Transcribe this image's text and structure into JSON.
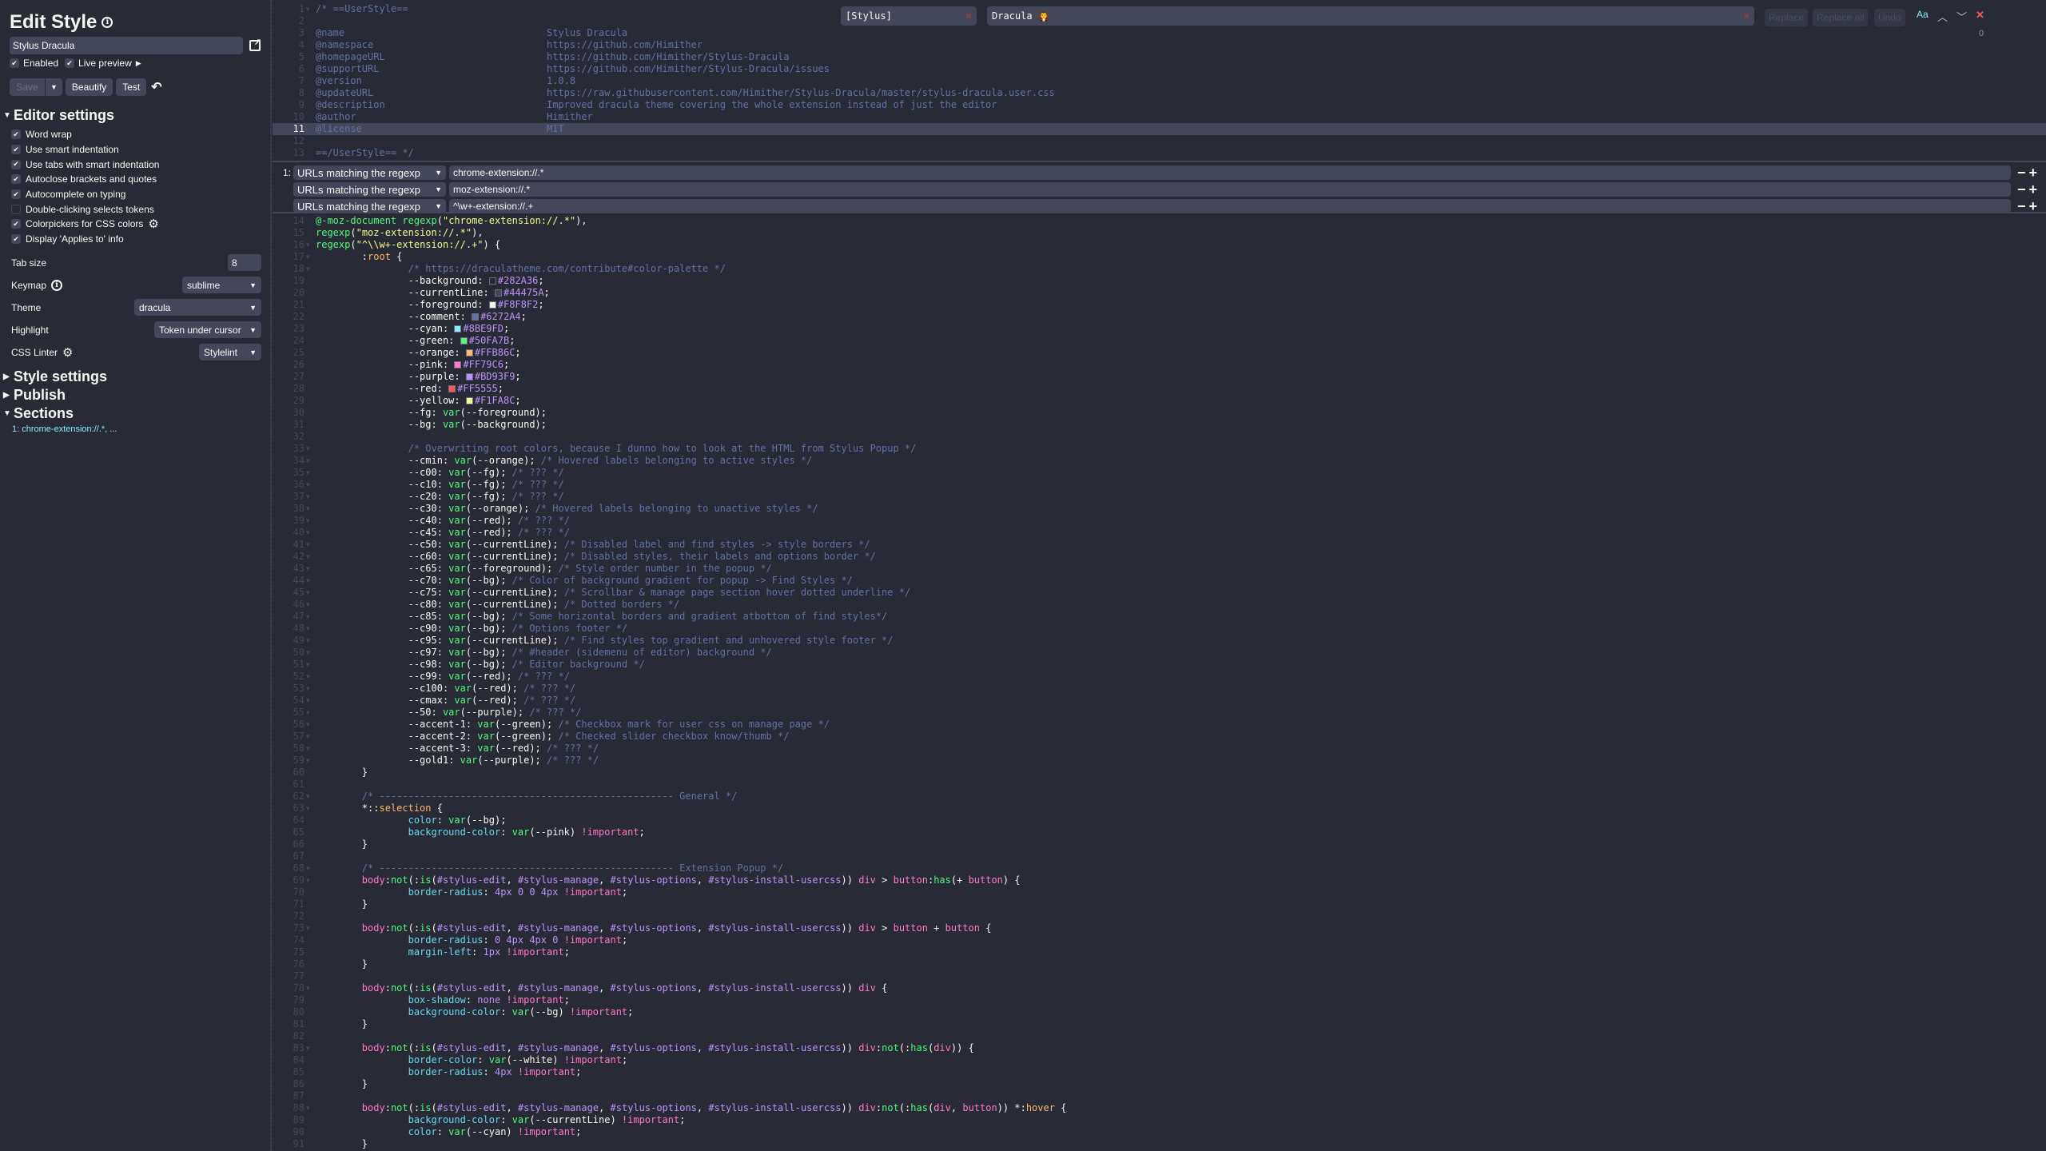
{
  "sidebar": {
    "title": "Edit Style",
    "style_name": "Stylus Dracula",
    "enabled_label": "Enabled",
    "enabled": true,
    "live_preview_label": "Live preview",
    "live_preview": true,
    "save_label": "Save",
    "beautify_label": "Beautify",
    "test_label": "Test",
    "editor_settings_heading": "Editor settings",
    "options": [
      {
        "label": "Word wrap",
        "checked": true
      },
      {
        "label": "Use smart indentation",
        "checked": true
      },
      {
        "label": "Use tabs with smart indentation",
        "checked": true
      },
      {
        "label": "Autoclose brackets and quotes",
        "checked": true
      },
      {
        "label": "Autocomplete on typing",
        "checked": true
      },
      {
        "label": "Double-clicking selects tokens",
        "checked": false
      },
      {
        "label": "Colorpickers for CSS colors",
        "checked": true
      },
      {
        "label": "Display 'Applies to' info",
        "checked": true
      }
    ],
    "tab_size_label": "Tab size",
    "tab_size": "8",
    "keymap_label": "Keymap",
    "keymap": "sublime",
    "theme_label": "Theme",
    "theme": "dracula",
    "highlight_label": "Highlight",
    "highlight": "Token under cursor",
    "linter_label": "CSS Linter",
    "linter": "Stylelint",
    "style_settings_heading": "Style settings",
    "publish_heading": "Publish",
    "sections_heading": "Sections",
    "sections_item": "1: chrome-extension://.*, ..."
  },
  "search": {
    "find_value": "[Stylus]",
    "replace_value": "Dracula 🧛",
    "replace_label": "Replace",
    "replace_all_label": "Replace all",
    "undo_label": "Undo",
    "case_label": "Aa",
    "count": "0"
  },
  "applies": {
    "rows": [
      {
        "num": "1:",
        "type": "URLs matching the regexp",
        "value": "chrome-extension://.*"
      },
      {
        "num": "",
        "type": "URLs matching the regexp",
        "value": "moz-extension://.*"
      },
      {
        "num": "",
        "type": "URLs matching the regexp",
        "value": "^\\w+-extension://.+"
      }
    ]
  },
  "header_code": {
    "active_line": 11,
    "lines": [
      {
        "n": "1",
        "fold": true,
        "html": "<span class='cm'>/* ==UserStyle==</span>"
      },
      {
        "n": "2",
        "html": ""
      },
      {
        "n": "3",
        "html": "<span class='cm'>@name                                   Stylus Dracula</span>"
      },
      {
        "n": "4",
        "html": "<span class='cm'>@namespace                              https://github.com/Himither</span>"
      },
      {
        "n": "5",
        "html": "<span class='cm'>@homepageURL                            https://github.com/Himither/Stylus-Dracula</span>"
      },
      {
        "n": "6",
        "html": "<span class='cm'>@supportURL                             https://github.com/Himither/Stylus-Dracula/issues</span>"
      },
      {
        "n": "7",
        "html": "<span class='cm'>@version                                1.0.8</span>"
      },
      {
        "n": "8",
        "html": "<span class='cm'>@updateURL                              https://raw.githubusercontent.com/Himither/Stylus-Dracula/master/stylus-dracula.user.css</span>"
      },
      {
        "n": "9",
        "html": "<span class='cm'>@description                            Improved dracula theme covering the whole extension instead of just the editor</span>"
      },
      {
        "n": "10",
        "html": "<span class='cm'>@author                                 Himither</span>"
      },
      {
        "n": "11",
        "html": "<span class='cm'>@license                                </span><span class='sel-txt'>MIT</span>"
      },
      {
        "n": "12",
        "html": ""
      },
      {
        "n": "13",
        "html": "<span class='cm'>==/UserStyle== */</span>"
      }
    ]
  },
  "body_code": {
    "lines": [
      {
        "n": "14",
        "html": "<span class='fn'>@-moz-document</span> <span class='fn'>regexp</span>(<span class='st'>\"chrome-extension://.*\"</span>),"
      },
      {
        "n": "15",
        "html": "<span class='fn'>regexp</span>(<span class='st'>\"moz-extension://.*\"</span>),"
      },
      {
        "n": "16",
        "fold": true,
        "html": "<span class='fn'>regexp</span>(<span class='st'>\"^\\\\w+-extension://.+\"</span>) {"
      },
      {
        "n": "17",
        "fold": true,
        "html": "\t:<span class='at'>root</span> {"
      },
      {
        "n": "18",
        "fold": true,
        "html": "\t\t<span class='cm'>/* https://draculatheme.com/contribute#color-palette */</span>"
      },
      {
        "n": "19",
        "html": "\t\t--background: <span class='sw' style='background:#282A36'></span><span class='nm'>#282A36</span>;"
      },
      {
        "n": "20",
        "html": "\t\t--currentLine: <span class='sw' style='background:#44475A'></span><span class='nm'>#44475A</span>;"
      },
      {
        "n": "21",
        "html": "\t\t--foreground: <span class='sw' style='background:#F8F8F2'></span><span class='nm'>#F8F8F2</span>;"
      },
      {
        "n": "22",
        "html": "\t\t--comment: <span class='sw' style='background:#6272A4'></span><span class='nm'>#6272A4</span>;"
      },
      {
        "n": "23",
        "html": "\t\t--cyan: <span class='sw' style='background:#8BE9FD'></span><span class='nm'>#8BE9FD</span>;"
      },
      {
        "n": "24",
        "html": "\t\t--green: <span class='sw' style='background:#50FA7B'></span><span class='nm'>#50FA7B</span>;"
      },
      {
        "n": "25",
        "html": "\t\t--orange: <span class='sw' style='background:#FFB86C'></span><span class='nm'>#FFB86C</span>;"
      },
      {
        "n": "26",
        "html": "\t\t--pink: <span class='sw' style='background:#FF79C6'></span><span class='nm'>#FF79C6</span>;"
      },
      {
        "n": "27",
        "html": "\t\t--purple: <span class='sw' style='background:#BD93F9'></span><span class='nm'>#BD93F9</span>;"
      },
      {
        "n": "28",
        "html": "\t\t--red: <span class='sw' style='background:#FF5555'></span><span class='nm'>#FF5555</span>;"
      },
      {
        "n": "29",
        "html": "\t\t--yellow: <span class='sw' style='background:#F1FA8C'></span><span class='nm'>#F1FA8C</span>;"
      },
      {
        "n": "30",
        "html": "\t\t--fg: <span class='fn'>var</span>(--foreground);"
      },
      {
        "n": "31",
        "html": "\t\t--bg: <span class='fn'>var</span>(--background);"
      },
      {
        "n": "32",
        "html": ""
      },
      {
        "n": "33",
        "fold": true,
        "html": "\t\t<span class='cm'>/* Overwriting root colors, because I dunno how to look at the HTML from Stylus Popup */</span>"
      },
      {
        "n": "34",
        "fold": true,
        "html": "\t\t--cmin: <span class='fn'>var</span>(--orange); <span class='cm'>/* Hovered labels belonging to active styles */</span>"
      },
      {
        "n": "35",
        "fold": true,
        "html": "\t\t--c00: <span class='fn'>var</span>(--fg); <span class='cm'>/* ??? */</span>"
      },
      {
        "n": "36",
        "fold": true,
        "html": "\t\t--c10: <span class='fn'>var</span>(--fg); <span class='cm'>/* ??? */</span>"
      },
      {
        "n": "37",
        "fold": true,
        "html": "\t\t--c20: <span class='fn'>var</span>(--fg); <span class='cm'>/* ??? */</span>"
      },
      {
        "n": "38",
        "fold": true,
        "html": "\t\t--c30: <span class='fn'>var</span>(--orange); <span class='cm'>/* Hovered labels belonging to unactive styles */</span>"
      },
      {
        "n": "39",
        "fold": true,
        "html": "\t\t--c40: <span class='fn'>var</span>(--red); <span class='cm'>/* ??? */</span>"
      },
      {
        "n": "40",
        "fold": true,
        "html": "\t\t--c45: <span class='fn'>var</span>(--red); <span class='cm'>/* ??? */</span>"
      },
      {
        "n": "41",
        "fold": true,
        "html": "\t\t--c50: <span class='fn'>var</span>(--currentLine); <span class='cm'>/* Disabled label and find styles -> style borders */</span>"
      },
      {
        "n": "42",
        "fold": true,
        "html": "\t\t--c60: <span class='fn'>var</span>(--currentLine); <span class='cm'>/* Disabled styles, their labels and options border */</span>"
      },
      {
        "n": "43",
        "fold": true,
        "html": "\t\t--c65: <span class='fn'>var</span>(--foreground); <span class='cm'>/* Style order number in the popup */</span>"
      },
      {
        "n": "44",
        "fold": true,
        "html": "\t\t--c70: <span class='fn'>var</span>(--bg); <span class='cm'>/* Color of background gradient for popup -> Find Styles */</span>"
      },
      {
        "n": "45",
        "fold": true,
        "html": "\t\t--c75: <span class='fn'>var</span>(--currentLine); <span class='cm'>/* Scrollbar &amp; manage page section hover dotted underline */</span>"
      },
      {
        "n": "46",
        "fold": true,
        "html": "\t\t--c80: <span class='fn'>var</span>(--currentLine); <span class='cm'>/* Dotted borders */</span>"
      },
      {
        "n": "47",
        "fold": true,
        "html": "\t\t--c85: <span class='fn'>var</span>(--bg); <span class='cm'>/* Some horizontal borders and gradient atbottom of find styles*/</span>"
      },
      {
        "n": "48",
        "fold": true,
        "html": "\t\t--c90: <span class='fn'>var</span>(--bg); <span class='cm'>/* Options footer */</span>"
      },
      {
        "n": "49",
        "fold": true,
        "html": "\t\t--c95: <span class='fn'>var</span>(--currentLine); <span class='cm'>/* Find styles top gradient and unhovered style footer */</span>"
      },
      {
        "n": "50",
        "fold": true,
        "html": "\t\t--c97: <span class='fn'>var</span>(--bg); <span class='cm'>/* #header (sidemenu of editor) background */</span>"
      },
      {
        "n": "51",
        "fold": true,
        "html": "\t\t--c98: <span class='fn'>var</span>(--bg); <span class='cm'>/* Editor background */</span>"
      },
      {
        "n": "52",
        "fold": true,
        "html": "\t\t--c99: <span class='fn'>var</span>(--red); <span class='cm'>/* ??? */</span>"
      },
      {
        "n": "53",
        "fold": true,
        "html": "\t\t--c100: <span class='fn'>var</span>(--red); <span class='cm'>/* ??? */</span>"
      },
      {
        "n": "54",
        "fold": true,
        "html": "\t\t--cmax: <span class='fn'>var</span>(--red); <span class='cm'>/* ??? */</span>"
      },
      {
        "n": "55",
        "fold": true,
        "html": "\t\t--50: <span class='fn'>var</span>(--purple); <span class='cm'>/* ??? */</span>"
      },
      {
        "n": "56",
        "fold": true,
        "html": "\t\t--accent-1: <span class='fn'>var</span>(--green); <span class='cm'>/* Checkbox mark for user css on manage page */</span>"
      },
      {
        "n": "57",
        "fold": true,
        "html": "\t\t--accent-2: <span class='fn'>var</span>(--green); <span class='cm'>/* Checked slider checkbox know/thumb */</span>"
      },
      {
        "n": "58",
        "fold": true,
        "html": "\t\t--accent-3: <span class='fn'>var</span>(--red); <span class='cm'>/* ??? */</span>"
      },
      {
        "n": "59",
        "fold": true,
        "html": "\t\t--gold1: <span class='fn'>var</span>(--purple); <span class='cm'>/* ??? */</span>"
      },
      {
        "n": "60",
        "html": "\t}"
      },
      {
        "n": "61",
        "html": ""
      },
      {
        "n": "62",
        "fold": true,
        "html": "\t<span class='cm'>/* --------------------------------------------------- General */</span>"
      },
      {
        "n": "63",
        "fold": true,
        "html": "\t*::<span class='at'>selection</span> {"
      },
      {
        "n": "64",
        "html": "\t\t<span class='pr'>color</span>: <span class='fn'>var</span>(--bg);"
      },
      {
        "n": "65",
        "html": "\t\t<span class='pr'>background-color</span>: <span class='fn'>var</span>(--pink) <span class='kw'>!important</span>;"
      },
      {
        "n": "66",
        "html": "\t}"
      },
      {
        "n": "67",
        "html": ""
      },
      {
        "n": "68",
        "fold": true,
        "html": "\t<span class='cm'>/* --------------------------------------------------- Extension Popup */</span>"
      },
      {
        "n": "69",
        "fold": true,
        "html": "\t<span class='kw'>body</span>:<span class='fn'>not</span>(:<span class='fn'>is</span>(<span class='nm'>#stylus-edit</span>, <span class='nm'>#stylus-manage</span>, <span class='nm'>#stylus-options</span>, <span class='nm'>#stylus-install-usercss</span>)) <span class='kw'>div</span> &gt; <span class='kw'>button</span>:<span class='fn'>has</span>(+ <span class='kw'>button</span>) {"
      },
      {
        "n": "70",
        "html": "\t\t<span class='pr'>border-radius</span>: <span class='nm'>4px 0 0 4px</span> <span class='kw'>!important</span>;"
      },
      {
        "n": "71",
        "html": "\t}"
      },
      {
        "n": "72",
        "html": ""
      },
      {
        "n": "73",
        "fold": true,
        "html": "\t<span class='kw'>body</span>:<span class='fn'>not</span>(:<span class='fn'>is</span>(<span class='nm'>#stylus-edit</span>, <span class='nm'>#stylus-manage</span>, <span class='nm'>#stylus-options</span>, <span class='nm'>#stylus-install-usercss</span>)) <span class='kw'>div</span> &gt; <span class='kw'>button</span> + <span class='kw'>button</span> {"
      },
      {
        "n": "74",
        "html": "\t\t<span class='pr'>border-radius</span>: <span class='nm'>0 4px 4px 0</span> <span class='kw'>!important</span>;"
      },
      {
        "n": "75",
        "html": "\t\t<span class='pr'>margin-left</span>: <span class='nm'>1px</span> <span class='kw'>!important</span>;"
      },
      {
        "n": "76",
        "html": "\t}"
      },
      {
        "n": "77",
        "html": ""
      },
      {
        "n": "78",
        "fold": true,
        "html": "\t<span class='kw'>body</span>:<span class='fn'>not</span>(:<span class='fn'>is</span>(<span class='nm'>#stylus-edit</span>, <span class='nm'>#stylus-manage</span>, <span class='nm'>#stylus-options</span>, <span class='nm'>#stylus-install-usercss</span>)) <span class='kw'>div</span> {"
      },
      {
        "n": "79",
        "html": "\t\t<span class='pr'>box-shadow</span>: <span class='nm'>none</span> <span class='kw'>!important</span>;"
      },
      {
        "n": "80",
        "html": "\t\t<span class='pr'>background-color</span>: <span class='fn'>var</span>(--bg) <span class='kw'>!important</span>;"
      },
      {
        "n": "81",
        "html": "\t}"
      },
      {
        "n": "82",
        "html": ""
      },
      {
        "n": "83",
        "fold": true,
        "html": "\t<span class='kw'>body</span>:<span class='fn'>not</span>(:<span class='fn'>is</span>(<span class='nm'>#stylus-edit</span>, <span class='nm'>#stylus-manage</span>, <span class='nm'>#stylus-options</span>, <span class='nm'>#stylus-install-usercss</span>)) <span class='kw'>div</span>:<span class='fn'>not</span>(:<span class='fn'>has</span>(<span class='kw'>div</span>)) {"
      },
      {
        "n": "84",
        "html": "\t\t<span class='pr'>border-color</span>: <span class='fn'>var</span>(--white) <span class='kw'>!important</span>;"
      },
      {
        "n": "85",
        "html": "\t\t<span class='pr'>border-radius</span>: <span class='nm'>4px</span> <span class='kw'>!important</span>;"
      },
      {
        "n": "86",
        "html": "\t}"
      },
      {
        "n": "87",
        "html": ""
      },
      {
        "n": "88",
        "fold": true,
        "html": "\t<span class='kw'>body</span>:<span class='fn'>not</span>(:<span class='fn'>is</span>(<span class='nm'>#stylus-edit</span>, <span class='nm'>#stylus-manage</span>, <span class='nm'>#stylus-options</span>, <span class='nm'>#stylus-install-usercss</span>)) <span class='kw'>div</span>:<span class='fn'>not</span>(:<span class='fn'>has</span>(<span class='kw'>div</span>, <span class='kw'>button</span>)) *:<span class='at'>hover</span> {"
      },
      {
        "n": "89",
        "html": "\t\t<span class='pr'>background-color</span>: <span class='fn'>var</span>(--currentLine) <span class='kw'>!important</span>;"
      },
      {
        "n": "90",
        "html": "\t\t<span class='pr'>color</span>: <span class='fn'>var</span>(--cyan) <span class='kw'>!important</span>;"
      },
      {
        "n": "91",
        "html": "\t}"
      }
    ]
  }
}
